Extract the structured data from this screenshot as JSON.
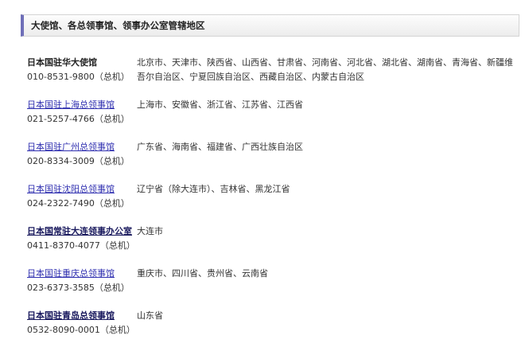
{
  "section": {
    "title": "大使馆、各总领事馆、领事办公室管辖地区"
  },
  "missions": [
    {
      "name": "日本国驻华大使馆",
      "phone": "010-8531-9800（总机）",
      "area": "北京市、天津市、陕西省、山西省、甘肃省、河南省、河北省、湖北省、湖南省、青海省、新疆维吾尔自治区、宁夏回族自治区、西藏自治区、内蒙古自治区"
    },
    {
      "name": "日本国驻上海总领事馆",
      "phone": "021-5257-4766（总机）",
      "area": "上海市、安徽省、浙江省、江苏省、江西省"
    },
    {
      "name": "日本国驻广州总领事馆",
      "phone": "020-8334-3009（总机）",
      "area": "广东省、海南省、福建省、广西壮族自治区"
    },
    {
      "name": "日本国驻沈阳总领事馆",
      "phone": "024-2322-7490（总机）",
      "area": "辽宁省（除大连市）、吉林省、黑龙江省"
    },
    {
      "name": "日本国常驻大连领事办公室",
      "phone": "0411-8370-4077（总机）",
      "area": "大连市"
    },
    {
      "name": "日本国驻重庆总领事馆",
      "phone": "023-6373-3585（总机）",
      "area": "重庆市、四川省、贵州省、云南省"
    },
    {
      "name": "日本国驻青岛总领事馆",
      "phone": "0532-8090-0001（总机）",
      "area": "山东省"
    }
  ]
}
